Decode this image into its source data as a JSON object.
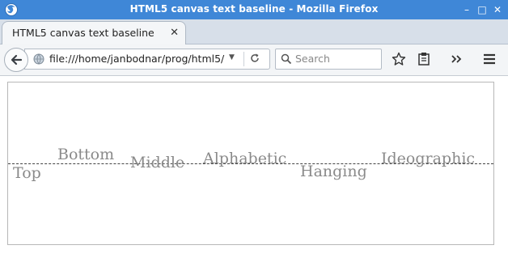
{
  "window": {
    "title": "HTML5 canvas text baseline - Mozilla Firefox"
  },
  "tab": {
    "title": "HTML5 canvas text baseline"
  },
  "navbar": {
    "url": "file:///home/janbodnar/prog/html5/",
    "search_placeholder": "Search"
  },
  "canvas": {
    "words": [
      "Top",
      "Bottom",
      "Middle",
      "Alphabetic",
      "Hanging",
      "Ideographic"
    ]
  }
}
